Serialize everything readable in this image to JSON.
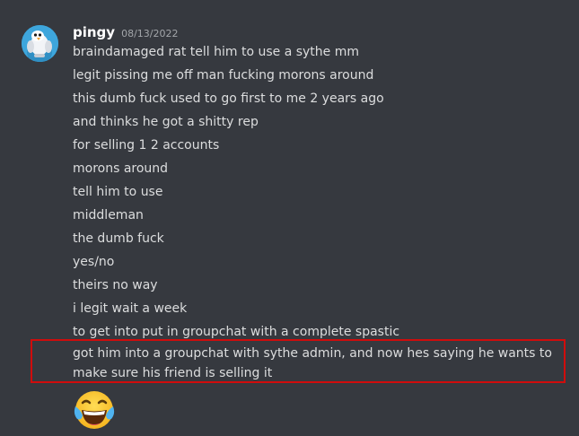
{
  "message": {
    "username": "pingy",
    "timestamp": "08/13/2022",
    "avatar_icon": "bird-avatar-icon",
    "lines": [
      "braindamaged rat tell him to use a sythe mm",
      "legit pissing me off man fucking morons around",
      "this dumb fuck used to go first to me 2 years ago",
      "and thinks he got a shitty rep",
      "for selling 1 2 accounts",
      "morons around",
      "tell him to use",
      "middleman",
      "the dumb fuck",
      "yes/no",
      "theirs no way",
      "i legit wait a week",
      "to get into put in groupchat with a complete spastic"
    ],
    "highlighted_line": "got him into a groupchat with sythe admin, and now hes saying he wants to make sure his friend is selling it",
    "reaction_emoji": "😂",
    "reaction_emoji_name": "joy-emoji-icon"
  },
  "colors": {
    "background": "#36393f",
    "text": "#dcddde",
    "username": "#ffffff",
    "timestamp": "#a3a6aa",
    "highlight_border": "#d00c0c"
  }
}
